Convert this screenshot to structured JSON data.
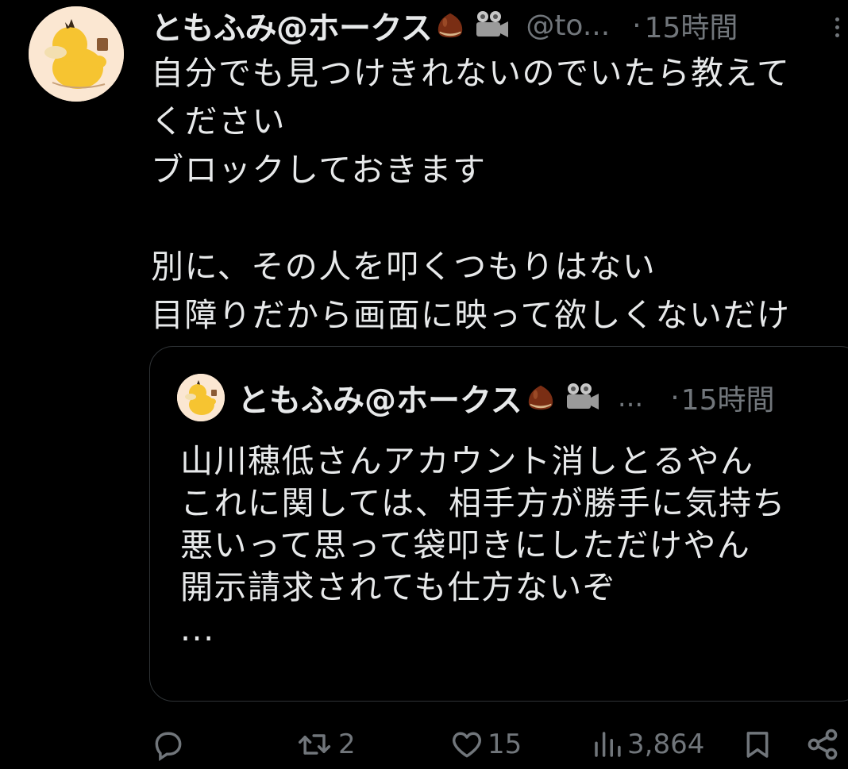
{
  "tweet": {
    "display_name": "ともふみ@ホークス",
    "handle": "@to...",
    "separator": "·",
    "time": "15時間",
    "body_lines": [
      "自分でも見つけきれないのでいたら教えて",
      "ください",
      "ブロックしておきます",
      "",
      "別に、その人を叩くつもりはない",
      "目障りだから画面に映って欲しくないだけ"
    ]
  },
  "quoted": {
    "display_name": "ともふみ@ホークス",
    "ellipsis": "...",
    "separator": "·",
    "time": "15時間",
    "body_lines": [
      "山川穂低さんアカウント消しとるやん",
      "これに関しては、相手方が勝手に気持ち",
      "悪いって思って袋叩きにしただけやん",
      "開示請求されても仕方ないぞ",
      "..."
    ]
  },
  "actions": {
    "reply_icon": "reply-icon",
    "retweet_icon": "retweet-icon",
    "retweet_count": "2",
    "like_icon": "heart-icon",
    "like_count": "15",
    "views_icon": "views-icon",
    "views_count": "3,864",
    "bookmark_icon": "bookmark-icon",
    "share_icon": "share-icon"
  },
  "colors": {
    "background": "#000000",
    "text": "#e7e9ea",
    "muted": "#71767b",
    "border": "#2f3336",
    "avatar_bg": "#fbe7d2",
    "duck_yellow": "#f6c431"
  }
}
